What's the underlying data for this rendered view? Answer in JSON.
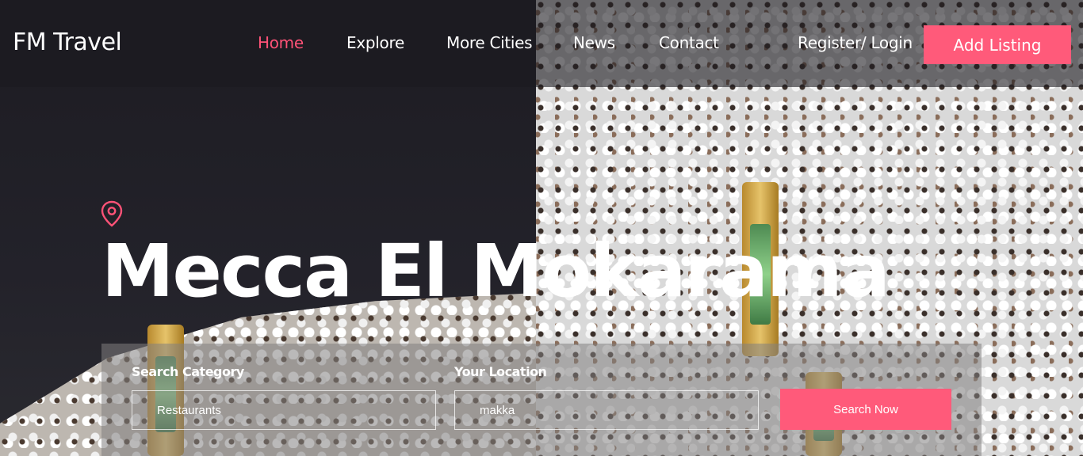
{
  "brand": {
    "name": "FM Travel"
  },
  "nav": {
    "items": [
      {
        "label": "Home",
        "active": true
      },
      {
        "label": "Explore"
      },
      {
        "label": "More Cities"
      },
      {
        "label": "News"
      },
      {
        "label": "Contact"
      }
    ],
    "auth_label": "Register/ Login",
    "add_listing_label": "Add Listing"
  },
  "hero": {
    "title": "Mecca El Mokarama",
    "icon": "location-pin-icon"
  },
  "search": {
    "category_label": "Search Category",
    "category_value": "Restaurants",
    "location_label": "Your Location",
    "location_value": "makka",
    "button_label": "Search Now"
  },
  "colors": {
    "accent": "#ff5a7a",
    "active_nav": "#ff5277",
    "header_bg": "#1c1b21"
  }
}
